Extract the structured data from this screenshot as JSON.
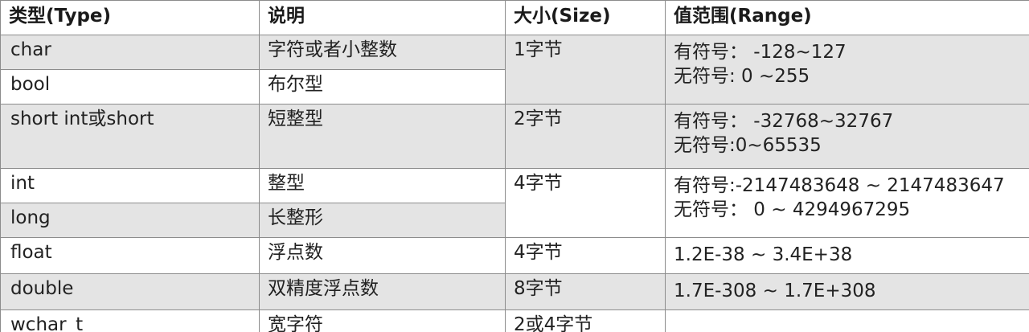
{
  "headers": {
    "type": "类型(Type)",
    "desc": "说明",
    "size": "大小(Size)",
    "range": "值范围(Range)"
  },
  "rows": [
    {
      "type": "char",
      "desc": "字符或者小整数"
    },
    {
      "type": "bool",
      "desc": "布尔型"
    },
    {
      "type": "short int或short",
      "desc": "短整型"
    },
    {
      "type": "int",
      "desc": "整型"
    },
    {
      "type": "long",
      "desc": "长整形"
    },
    {
      "type": "float",
      "desc": "浮点数"
    },
    {
      "type": "double",
      "desc": "双精度浮点数"
    },
    {
      "type": "wchar_t",
      "desc": "宽字符"
    }
  ],
  "sizes": {
    "char_bool": "1字节",
    "short": "2字节",
    "int_long": "4字节",
    "float": "4字节",
    "double": "8字节",
    "wchar_t": "2或4字节"
  },
  "ranges": {
    "char_bool": [
      "有符号：  -128~127",
      "无符号: 0 ~255"
    ],
    "short": [
      "有符号：  -32768~32767",
      "无符号:0~65535"
    ],
    "int_long": [
      "有符号:-2147483648 ~ 2147483647",
      "无符号：  0 ~ 4294967295"
    ],
    "float": "1.2E-38 ~ 3.4E+38",
    "double": "1.7E-308 ~ 1.7E+308",
    "wchar_t": ""
  }
}
